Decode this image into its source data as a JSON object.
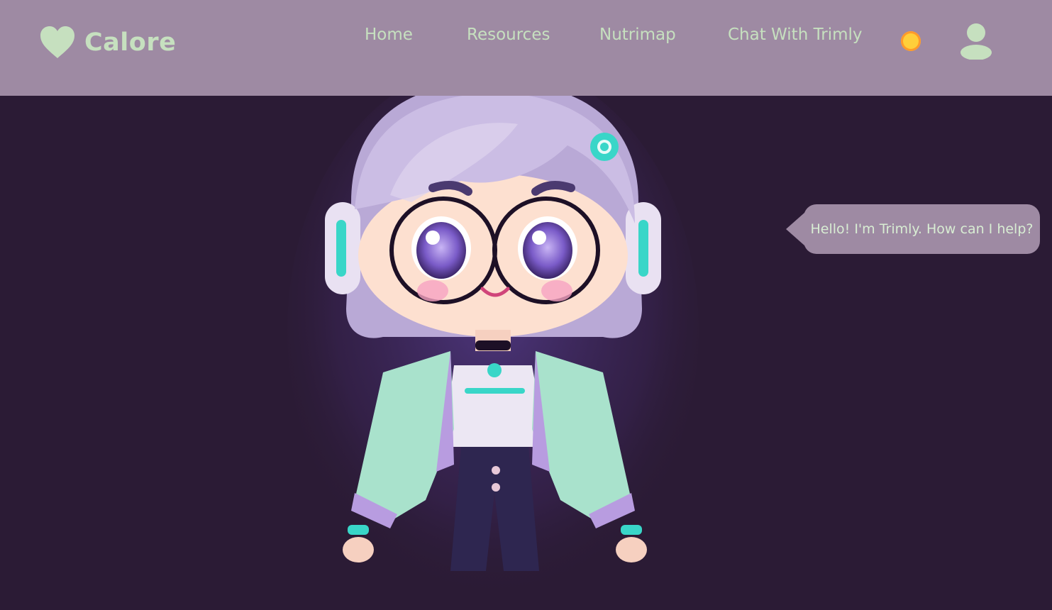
{
  "brand": {
    "name": "Calore",
    "icon": "heart-icon"
  },
  "nav": {
    "links": [
      {
        "label": "Home"
      },
      {
        "label": "Resources"
      },
      {
        "label": "Nutrimap"
      },
      {
        "label": "Chat With Trimly"
      }
    ],
    "theme_toggle_icon": "sun-icon",
    "profile_icon": "user-icon"
  },
  "chat": {
    "bubble_text": "Hello! I'm Trimly. How can I help?"
  },
  "colors": {
    "navbar_bg": "#9e8aa3",
    "page_bg": "#2b1b35",
    "accent_text": "#c6e0bf",
    "sun": "#ffcf3a"
  }
}
